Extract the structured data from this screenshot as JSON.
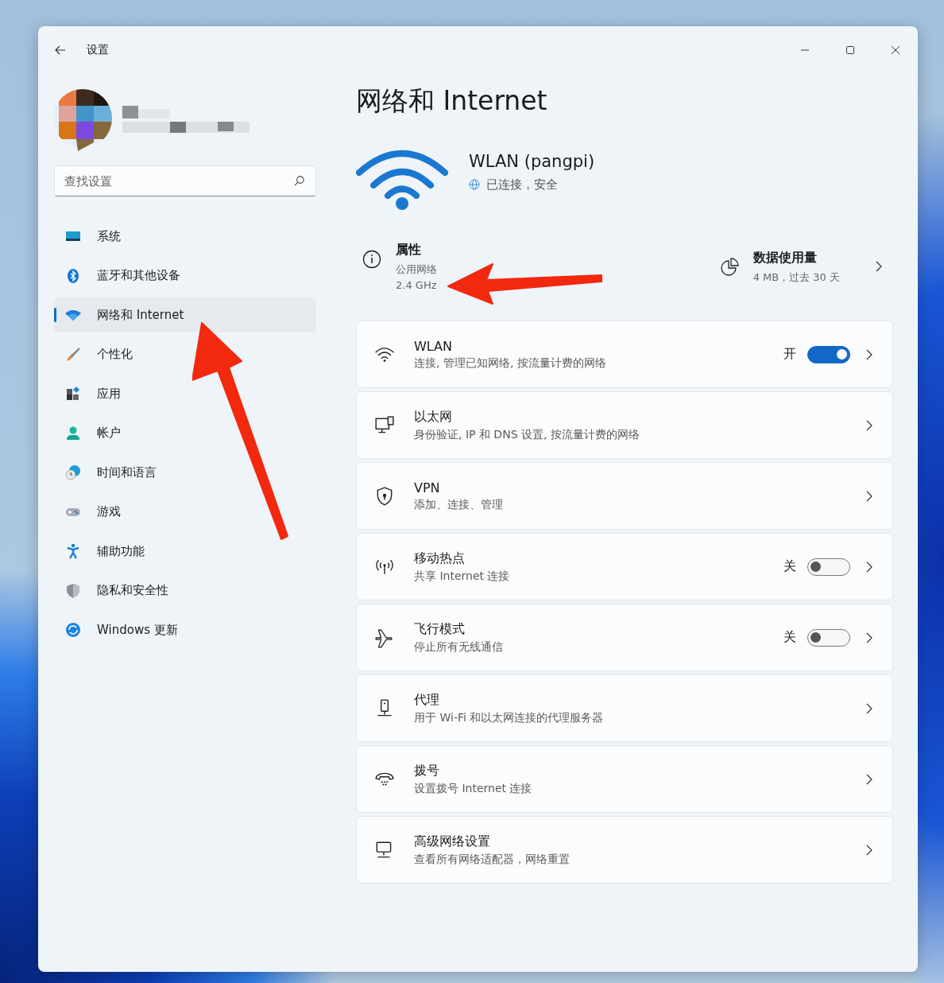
{
  "window": {
    "title": "设置"
  },
  "search": {
    "placeholder": "查找设置"
  },
  "sidebar": {
    "items": [
      {
        "label": "系统",
        "selected": false
      },
      {
        "label": "蓝牙和其他设备",
        "selected": false
      },
      {
        "label": "网络和 Internet",
        "selected": true
      },
      {
        "label": "个性化",
        "selected": false
      },
      {
        "label": "应用",
        "selected": false
      },
      {
        "label": "帐户",
        "selected": false
      },
      {
        "label": "时间和语言",
        "selected": false
      },
      {
        "label": "游戏",
        "selected": false
      },
      {
        "label": "辅助功能",
        "selected": false
      },
      {
        "label": "隐私和安全性",
        "selected": false
      },
      {
        "label": "Windows 更新",
        "selected": false
      }
    ]
  },
  "page": {
    "title": "网络和 Internet"
  },
  "connection": {
    "name": "WLAN (pangpi)",
    "status": "已连接，安全"
  },
  "properties": {
    "title": "属性",
    "lines": [
      "公用网络",
      "2.4 GHz"
    ]
  },
  "data_usage": {
    "title": "数据使用量",
    "detail": "4 MB，过去 30 天"
  },
  "settings": [
    {
      "title": "WLAN",
      "subtitle": "连接, 管理已知网络, 按流量计费的网络",
      "kind": "toggle",
      "state_label": "开",
      "on": true
    },
    {
      "title": "以太网",
      "subtitle": "身份验证, IP 和 DNS 设置, 按流量计费的网络",
      "kind": "link"
    },
    {
      "title": "VPN",
      "subtitle": "添加、连接、管理",
      "kind": "link"
    },
    {
      "title": "移动热点",
      "subtitle": "共享 Internet 连接",
      "kind": "toggle",
      "state_label": "关",
      "on": false
    },
    {
      "title": "飞行模式",
      "subtitle": "停止所有无线通信",
      "kind": "toggle",
      "state_label": "关",
      "on": false
    },
    {
      "title": "代理",
      "subtitle": "用于 Wi-Fi 和以太网连接的代理服务器",
      "kind": "link"
    },
    {
      "title": "拨号",
      "subtitle": "设置拨号 Internet 连接",
      "kind": "link"
    },
    {
      "title": "高级网络设置",
      "subtitle": "查看所有网络适配器，网络重置",
      "kind": "link"
    }
  ]
}
